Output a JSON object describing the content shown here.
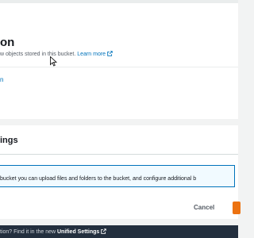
{
  "top_section": {
    "title_fragment": "on",
    "description_fragment": "w objects stored in this bucket.",
    "learn_more": "Learn more",
    "blue_fragment": "n"
  },
  "upload_section": {
    "title_fragment": "ings",
    "info_text": "bucket you can upload files and folders to the bucket, and configure additional b"
  },
  "actions": {
    "cancel_label": "Cancel"
  },
  "footer": {
    "prompt_fragment": "tion? Find it in the new",
    "link_label": "Unified Settings"
  },
  "colors": {
    "link": "#0073bb",
    "primary": "#ec7211",
    "footer_bg": "#232f3e",
    "info_border": "#0073bb"
  },
  "icons": [
    "external-link-icon",
    "mouse-cursor-icon"
  ]
}
